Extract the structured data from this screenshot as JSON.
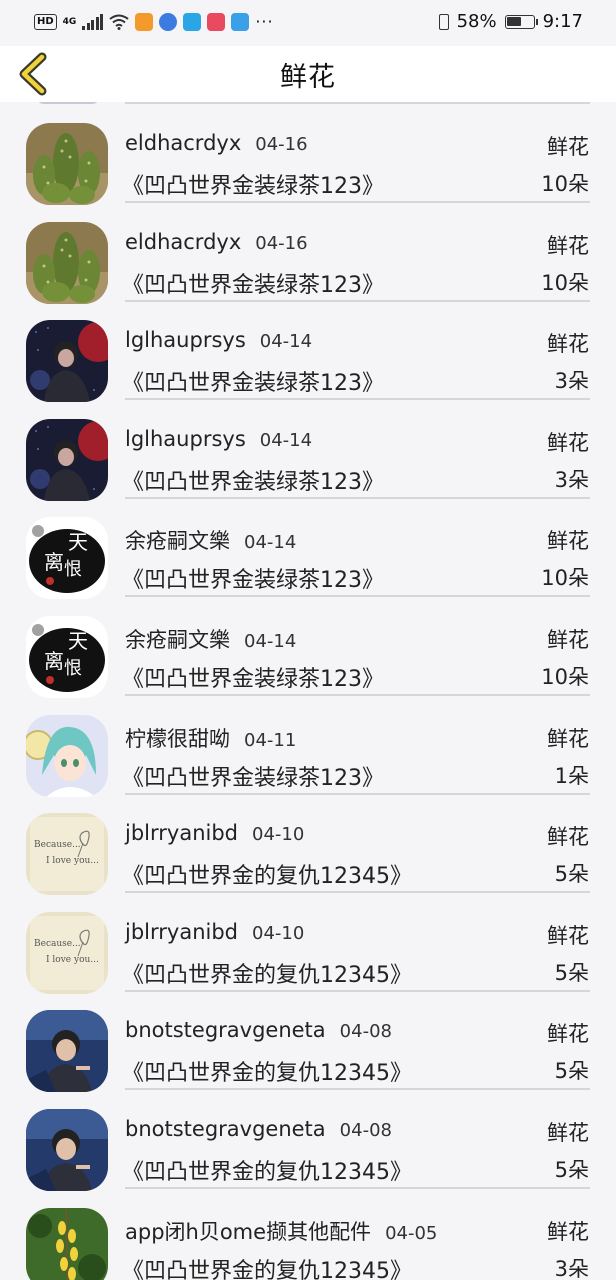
{
  "status_bar": {
    "network": "HD",
    "signal": "4G",
    "battery_level": 0.58,
    "battery_text": "58%",
    "time": "9:17",
    "more": "···"
  },
  "header": {
    "title": "鲜花"
  },
  "rows": [
    {
      "user": "eldhacrdyx",
      "date": "04-16",
      "type": "鲜花",
      "product": "《凹凸世界金装绿茶123》",
      "count": "10朵",
      "avatar": "cactus"
    },
    {
      "user": "eldhacrdyx",
      "date": "04-16",
      "type": "鲜花",
      "product": "《凹凸世界金装绿茶123》",
      "count": "10朵",
      "avatar": "cactus"
    },
    {
      "user": "lglhauprsys",
      "date": "04-14",
      "type": "鲜花",
      "product": "《凹凸世界金装绿茶123》",
      "count": "3朵",
      "avatar": "singer"
    },
    {
      "user": "lglhauprsys",
      "date": "04-14",
      "type": "鲜花",
      "product": "《凹凸世界金装绿茶123》",
      "count": "3朵",
      "avatar": "singer"
    },
    {
      "user": "余疮嗣文樂",
      "date": "04-14",
      "type": "鲜花",
      "product": "《凹凸世界金装绿茶123》",
      "count": "10朵",
      "avatar": "ink"
    },
    {
      "user": "余疮嗣文樂",
      "date": "04-14",
      "type": "鲜花",
      "product": "《凹凸世界金装绿茶123》",
      "count": "10朵",
      "avatar": "ink"
    },
    {
      "user": "柠檬很甜呦",
      "date": "04-11",
      "type": "鲜花",
      "product": "《凹凸世界金装绿茶123》",
      "count": "1朵",
      "avatar": "anime"
    },
    {
      "user": "jblrryanibd",
      "date": "04-10",
      "type": "鲜花",
      "product": "《凹凸世界金的复仇12345》",
      "count": "5朵",
      "avatar": "paper"
    },
    {
      "user": "jblrryanibd",
      "date": "04-10",
      "type": "鲜花",
      "product": "《凹凸世界金的复仇12345》",
      "count": "5朵",
      "avatar": "paper"
    },
    {
      "user": "bnotstegravgeneta",
      "date": "04-08",
      "type": "鲜花",
      "product": "《凹凸世界金的复仇12345》",
      "count": "5朵",
      "avatar": "boy"
    },
    {
      "user": "bnotstegravgeneta",
      "date": "04-08",
      "type": "鲜花",
      "product": "《凹凸世界金的复仇12345》",
      "count": "5朵",
      "avatar": "boy"
    },
    {
      "user": "app闭h贝ome撷其他配件",
      "date": "04-05",
      "type": "鲜花",
      "product": "《凹凸世界金的复仇12345》",
      "count": "3朵",
      "avatar": "flowers"
    }
  ],
  "avatar_paper_text": "Because... I love you..."
}
